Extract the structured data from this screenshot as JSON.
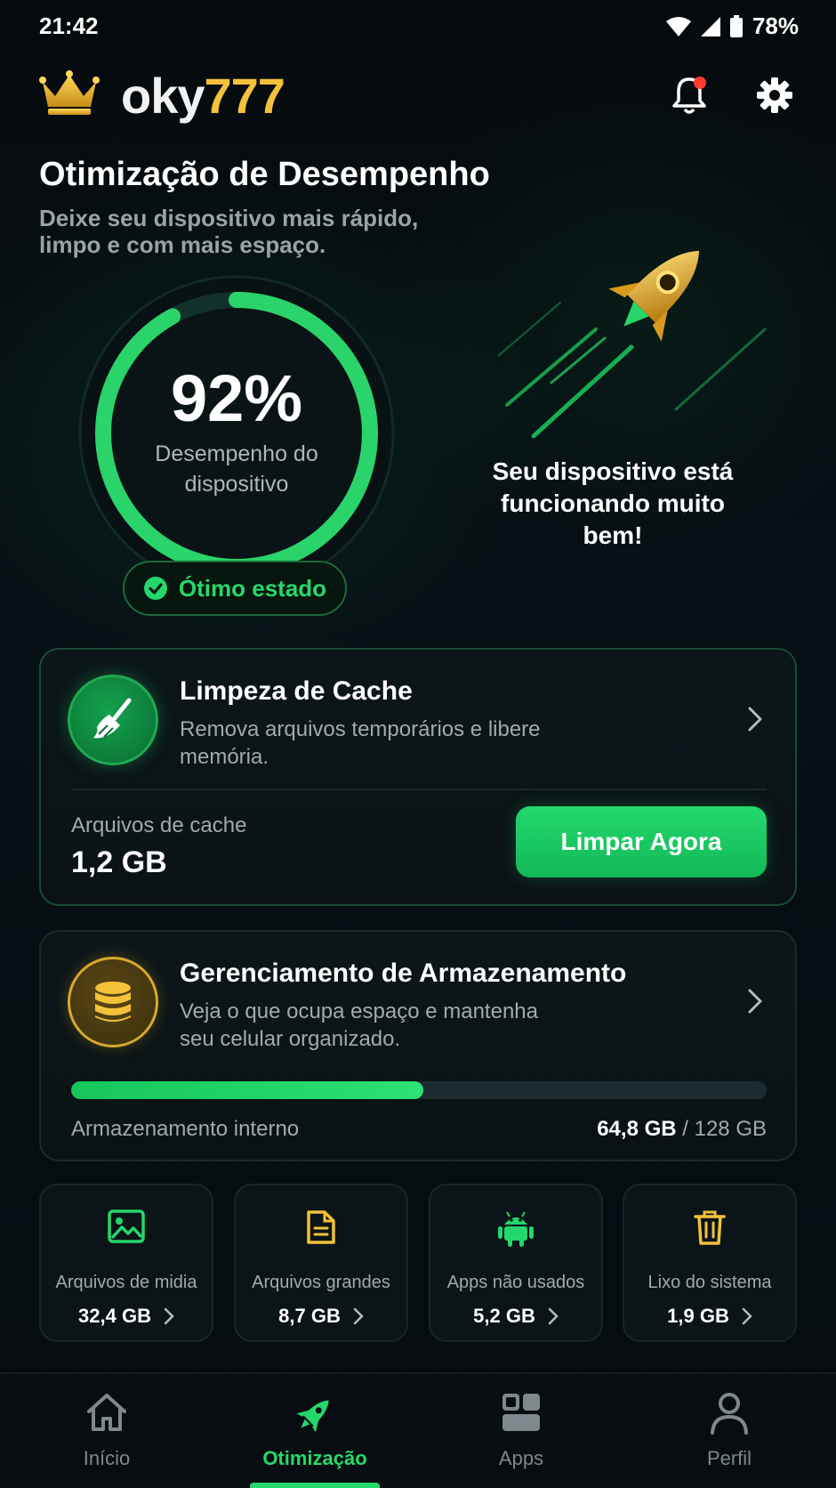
{
  "status_bar": {
    "time": "21:42",
    "battery": "78%"
  },
  "header": {
    "logo_part1": "oky",
    "logo_part2": "777",
    "notification_dot": true
  },
  "page": {
    "title": "Otimização de Desempenho",
    "subtitle": "Deixe seu dispositivo mais rápido, limpo e com mais espaço."
  },
  "performance": {
    "value_percent": 92,
    "value_text": "92%",
    "label": "Desempenho do dispositivo",
    "status": "Ótimo estado",
    "message": "Seu dispositivo está funcionando muito bem!"
  },
  "cache_card": {
    "title": "Limpeza de Cache",
    "description": "Remova arquivos temporários e libere memória.",
    "files_label": "Arquivos de cache",
    "files_value": "1,2 GB",
    "button_label": "Limpar Agora"
  },
  "storage_card": {
    "title": "Gerenciamento de Armazenamento",
    "description": "Veja o que ocupa espaço e mantenha seu celular organizado.",
    "storage_label": "Armazenamento interno",
    "used": "64,8 GB",
    "total": "128 GB",
    "used_fraction": 0.506
  },
  "tiles": [
    {
      "label": "Arquivos de midia",
      "value": "32,4 GB",
      "icon": "image-icon"
    },
    {
      "label": "Arquivos grandes",
      "value": "8,7 GB",
      "icon": "document-icon"
    },
    {
      "label": "Apps não usados",
      "value": "5,2 GB",
      "icon": "android-icon"
    },
    {
      "label": "Lixo do sistema",
      "value": "1,9 GB",
      "icon": "trash-icon"
    }
  ],
  "nav": [
    {
      "label": "Início",
      "icon": "home-icon",
      "active": false
    },
    {
      "label": "Otimização",
      "icon": "rocket-icon",
      "active": true
    },
    {
      "label": "Apps",
      "icon": "apps-icon",
      "active": false
    },
    {
      "label": "Perfil",
      "icon": "person-icon",
      "active": false
    }
  ],
  "colors": {
    "accent": "#22d86c",
    "gold": "#f3c13a",
    "background": "#060b0e"
  }
}
